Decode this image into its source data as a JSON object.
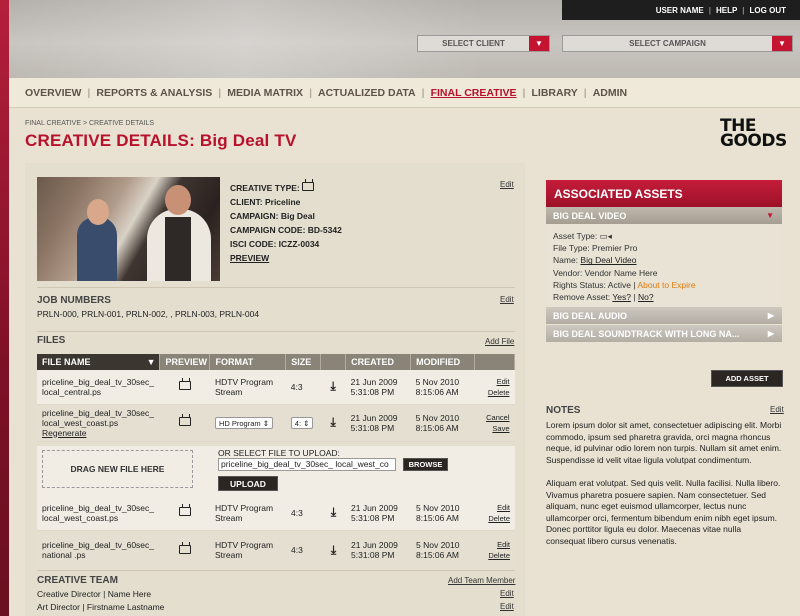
{
  "userbar": {
    "user": "USER NAME",
    "help": "HELP",
    "logout": "LOG OUT",
    "sep": "|"
  },
  "selects": {
    "client": "SELECT CLIENT",
    "campaign": "SELECT CAMPAIGN"
  },
  "nav": {
    "items": [
      "OVERVIEW",
      "REPORTS & ANALYSIS",
      "MEDIA MATRIX",
      "ACTUALIZED DATA",
      "FINAL CREATIVE",
      "LIBRARY",
      "ADMIN"
    ],
    "active_index": 4,
    "sep": "|"
  },
  "breadcrumb": "FINAL CREATIVE > CREATIVE DETAILS",
  "page_title": "CREATIVE DETAILS: Big Deal TV",
  "logo": {
    "line1": "THE",
    "line2": "GOODS"
  },
  "details": {
    "creative_type_label": "CREATIVE TYPE:",
    "client_label": "CLIENT:",
    "client": "Priceline",
    "campaign_label": "CAMPAIGN:",
    "campaign": "Big Deal",
    "campaign_code_label": "CAMPAIGN CODE:",
    "campaign_code": "BD-5342",
    "isci_label": "ISCI CODE:",
    "isci": "ICZZ-0034",
    "preview": "PREVIEW",
    "edit": "Edit"
  },
  "job_numbers": {
    "title": "JOB NUMBERS",
    "value": "PRLN-000, PRLN-001, PRLN-002, , PRLN-003, PRLN-004",
    "edit": "Edit"
  },
  "files": {
    "title": "FILES",
    "add": "Add File",
    "columns": [
      "FILE NAME",
      "PREVIEW",
      "FORMAT",
      "SIZE",
      "",
      "CREATED",
      "MODIFIED",
      ""
    ],
    "rows": [
      {
        "name": "priceline_big_deal_tv_30sec_ local_central.ps",
        "format": "HDTV Program Stream",
        "size": "4:3",
        "created": "21 Jun 2009 5:31:08 PM",
        "modified": "5 Nov 2010 8:15:06 AM",
        "a1": "Edit",
        "a2": "Delete"
      },
      {
        "name": "priceline_big_deal_tv_30sec_ local_west_coast.ps",
        "regen": "Regenerate",
        "format": "HD Program",
        "size": "4:",
        "created": "21 Jun 2009 5:31:08 PM",
        "modified": "5 Nov 2010 8:15:06 AM",
        "a1": "Cancel",
        "a2": "Save"
      },
      {
        "name": "priceline_big_deal_tv_30sec_ local_west_coast.ps",
        "format": "HDTV Program Stream",
        "size": "4:3",
        "created": "21 Jun 2009 5:31:08 PM",
        "modified": "5 Nov 2010 8:15:06 AM",
        "a1": "Edit",
        "a2": "Delete"
      },
      {
        "name": "priceline_big_deal_tv_60sec_ national .ps",
        "format": "HDTV Program Stream",
        "size": "4:3",
        "created": "21 Jun 2009 5:31:08 PM",
        "modified": "5 Nov 2010 8:15:06 AM",
        "a1": "Edit",
        "a2": "Delete"
      }
    ],
    "upload": {
      "drag": "DRAG NEW FILE HERE",
      "or_select": "OR SELECT FILE TO UPLOAD:",
      "path": "priceline_big_deal_tv_30sec_ local_west_co",
      "browse": "BROWSE",
      "upload": "UPLOAD"
    }
  },
  "team": {
    "title": "CREATIVE TEAM",
    "add": "Add Team Member",
    "members": [
      {
        "text": "Creative Director | Name Here",
        "edit": "Edit"
      },
      {
        "text": "Art Director | Firstname Lastname",
        "edit": "Edit"
      }
    ]
  },
  "assets": {
    "title": "ASSOCIATED ASSETS",
    "open": {
      "title": "BIG DEAL VIDEO",
      "asset_type_label": "Asset Type:",
      "file_type": "File Type: Premier Pro",
      "name_label": "Name:",
      "name": "Big Deal Video",
      "vendor": "Vendor: Vendor Name Here",
      "rights_label": "Rights Status: Active |",
      "rights_link": "About to Expire",
      "remove_label": "Remove Asset:",
      "yes": "Yes?",
      "no": "No?",
      "sep": "|"
    },
    "collapsed": [
      "BIG DEAL AUDIO",
      "BIG DEAL SOUNDTRACK WITH LONG NA..."
    ],
    "add": "ADD ASSET"
  },
  "notes": {
    "title": "NOTES",
    "edit": "Edit",
    "p1": "Lorem ipsum dolor sit amet, consectetuer adipiscing elit. Morbi commodo, ipsum sed pharetra gravida, orci magna rhoncus neque, id pulvinar odio lorem non turpis. Nullam sit amet enim. Suspendisse id velit vitae ligula volutpat condimentum.",
    "p2": "Aliquam erat volutpat. Sed quis velit. Nulla facilisi. Nulla libero. Vivamus pharetra posuere sapien. Nam consectetuer. Sed aliquam, nunc eget euismod ullamcorper, lectus nunc ullamcorper orci, fermentum bibendum enim nibh eget ipsum. Donec porttitor ligula eu dolor. Maecenas vitae nulla consequat libero cursus venenatis."
  }
}
